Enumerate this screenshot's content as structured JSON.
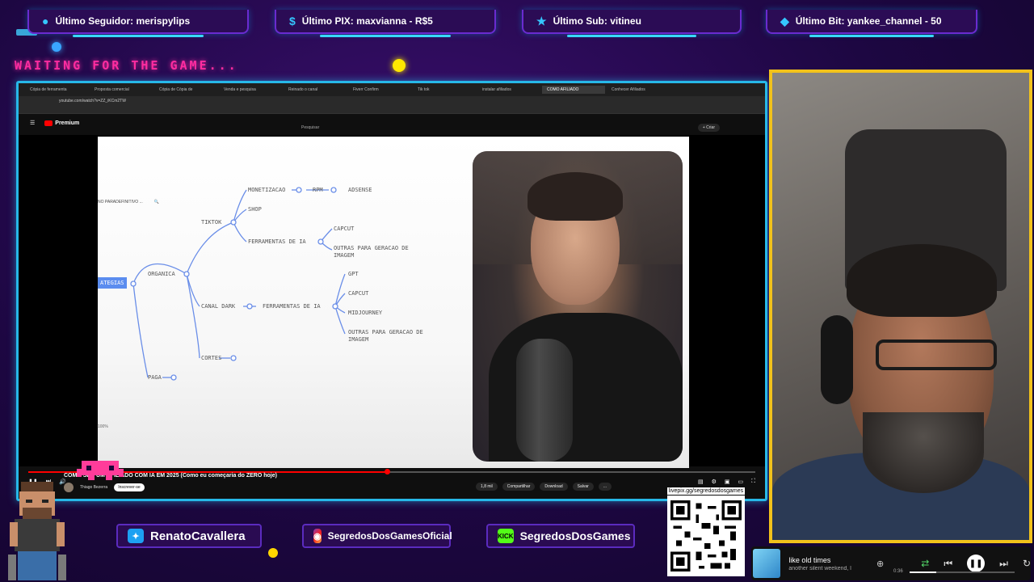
{
  "alerts": [
    {
      "icon": "user-icon",
      "label": "Último Seguidor: merispylips"
    },
    {
      "icon": "dollar-icon",
      "label": "Último PIX: maxvianna - R$5"
    },
    {
      "icon": "star-icon",
      "label": "Último Sub: vitineu"
    },
    {
      "icon": "diamond-icon",
      "label": "Último Bit: yankee_channel - 50"
    }
  ],
  "waiting_text": "WAITING FOR THE GAME...",
  "browser": {
    "tabs": [
      "Cópia de ferramenta",
      "Proposta comercial",
      "Cópia de Cópia de",
      "Venda e pesquisa",
      "Reinado o canal",
      "Fiverr Confirm",
      "Tik tok",
      "instalar afiliados",
      "COMO AFILIADO",
      "Conhecer Afiliados"
    ],
    "address": "youtube.com/watch?v=ZZ_iKCm2TW"
  },
  "youtube": {
    "brand": "Premium",
    "search_placeholder": "Pesquisar",
    "create_label": "+ Criar",
    "video_title": "COMO SER UM AFILIADO COM IA EM 2025 (Como eu começaria do ZERO hoje)",
    "channel": "Thiago Bezerra",
    "subscribe_label": "Inscrever-se",
    "actions": [
      "1,8 mil",
      "Compartilhar",
      "Download",
      "Salvar",
      "..."
    ],
    "progress": 0.49
  },
  "mindmap": {
    "search_text": "NO PARADEFINITIVO ...",
    "zoom": "100%",
    "nodes": {
      "root": "ATEGIAS",
      "organica": "ORGANICA",
      "paga": "PAGA",
      "tiktok": "TIKTOK",
      "canal_dark": "CANAL DARK",
      "cortes": "CORTES",
      "monetizacao": "MONETIZACAO",
      "rpm": "RPM",
      "adsense": "ADSENSE",
      "shop": "SHOP",
      "ferramentas_ia_1": "FERRAMENTAS DE IA",
      "capcut_1": "CAPCUT",
      "outras_1": "OUTRAS PARA GERACAO DE IMAGEM",
      "ferramentas_ia_2": "FERRAMENTAS DE IA",
      "gpt": "GPT",
      "capcut_2": "CAPCUT",
      "midjourney": "MIDJOURNEY",
      "outras_2": "OUTRAS PARA GERACAO DE IMAGEM"
    }
  },
  "socials": {
    "twitter": "RenatoCavallera",
    "instagram": "SegredosDosGamesOficial",
    "kick_badge": "KICK",
    "kick": "SegredosDosGames"
  },
  "qr_label": "livepix.gg/segredosdosgames",
  "music": {
    "song": "like old times",
    "artist": "another silent weekend, l",
    "time": "0:36",
    "progress": 0.25
  },
  "colors": {
    "frame": "#27b8e8",
    "cam_border": "#f2c21b",
    "accent_pink": "#ff2ca0",
    "root_node": "#5b8def"
  }
}
